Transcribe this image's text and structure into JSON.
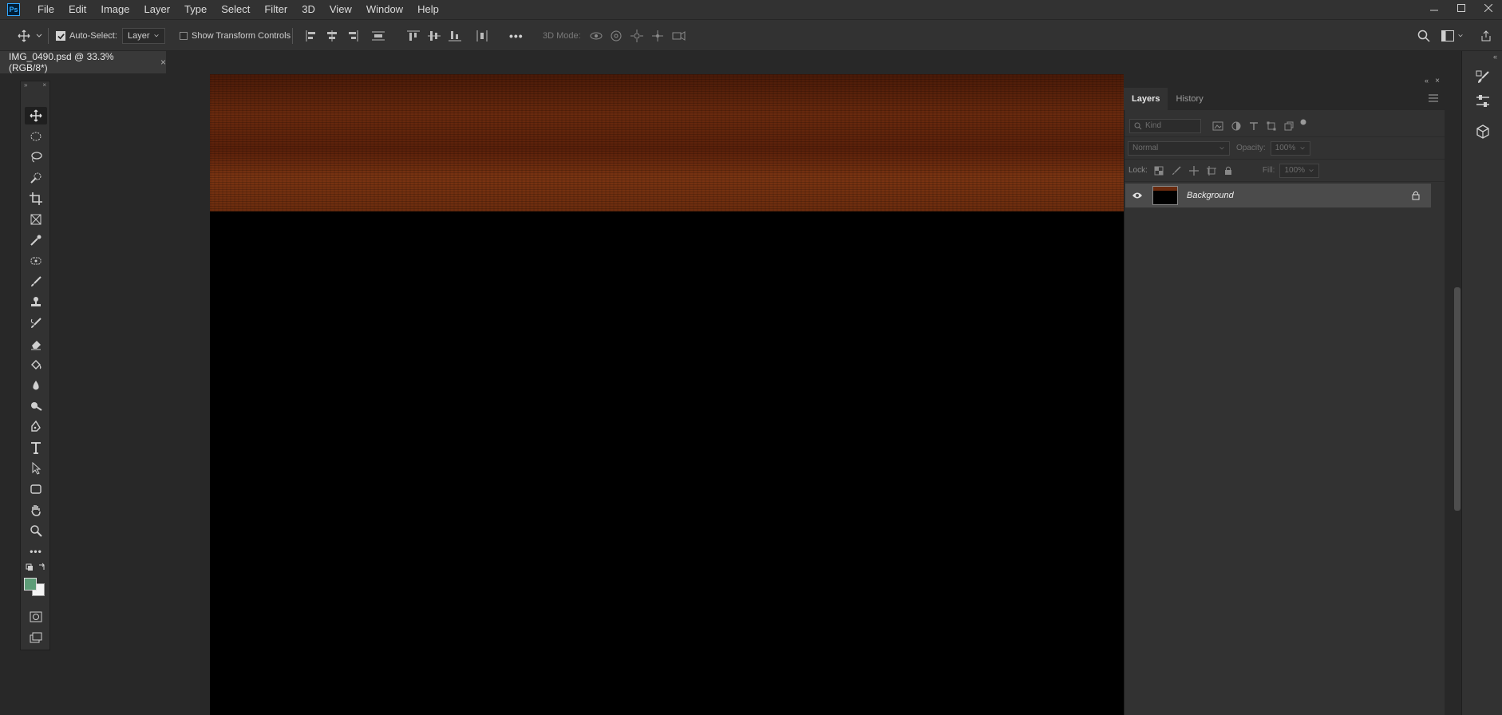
{
  "app": {
    "logo_text": "Ps"
  },
  "menu": [
    "File",
    "Edit",
    "Image",
    "Layer",
    "Type",
    "Select",
    "Filter",
    "3D",
    "View",
    "Window",
    "Help"
  ],
  "options_bar": {
    "auto_select_label": "Auto-Select:",
    "auto_select_checked": true,
    "auto_select_target": "Layer",
    "show_transform_label": "Show Transform Controls",
    "show_transform_checked": false,
    "more_label": "•••",
    "mode_3d_label": "3D Mode:"
  },
  "document": {
    "tab_title": "IMG_0490.psd @ 33.3% (RGB/8*)",
    "close_glyph": "×"
  },
  "tools": {
    "more_glyph": "•••",
    "foreground_color": "#5d9c77",
    "background_color": "#f4f4f4"
  },
  "layers_panel": {
    "tabs": [
      "Layers",
      "History"
    ],
    "active_tab": "Layers",
    "filter_label": "Kind",
    "blend_mode": "Normal",
    "opacity_label": "Opacity:",
    "opacity_value": "100%",
    "lock_label": "Lock:",
    "fill_label": "Fill:",
    "fill_value": "100%",
    "layers": [
      {
        "name": "Background",
        "visible": true,
        "locked": true
      }
    ]
  },
  "canvas": {
    "wood_color": "#6a2a0e",
    "black_color": "#000000"
  }
}
